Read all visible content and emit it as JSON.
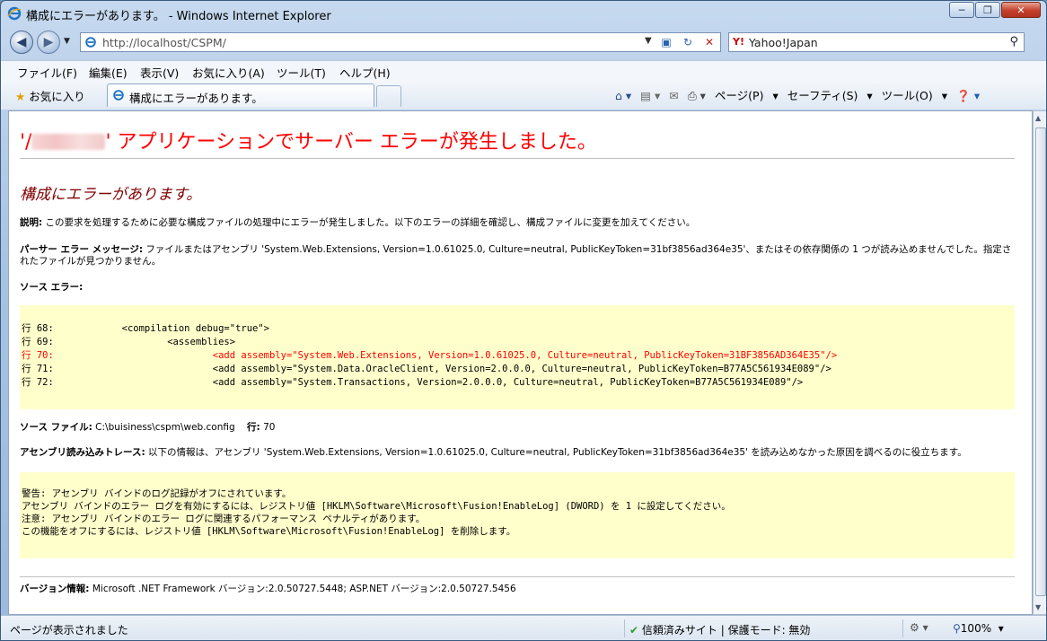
{
  "window": {
    "title": "構成にエラーがあります。 - Windows Internet Explorer"
  },
  "address_bar": {
    "url": "http://localhost/CSPM/"
  },
  "search_box": {
    "provider": "Yahoo!Japan"
  },
  "menu": {
    "items": [
      "ファイル(F)",
      "編集(E)",
      "表示(V)",
      "お気に入り(A)",
      "ツール(T)",
      "ヘルプ(H)"
    ]
  },
  "favorites_bar": {
    "favorites_label": "お気に入り",
    "tab_title": "構成にエラーがあります。",
    "page_menu": "ページ(P)",
    "safety_menu": "セーフティ(S)",
    "tools_menu": "ツール(O)"
  },
  "page": {
    "heading_prefix": "'/",
    "heading_suffix": "' アプリケーションでサーバー エラーが発生しました。",
    "subheading": "構成にエラーがあります。",
    "description_label": "説明:",
    "description_text": " この要求を処理するために必要な構成ファイルの処理中にエラーが発生しました。以下のエラーの詳細を確認し、構成ファイルに変更を加えてください。",
    "parser_label": "パーサー エラー メッセージ:",
    "parser_text": " ファイルまたはアセンブリ 'System.Web.Extensions, Version=1.0.61025.0, Culture=neutral, PublicKeyToken=31bf3856ad364e35'、またはその依存関係の 1 つが読み込めませんでした。指定されたファイルが見つかりません。",
    "source_error_label": "ソース エラー:",
    "source_lines": [
      {
        "text": "行 68:            <compilation debug=\"true\">",
        "highlight": false
      },
      {
        "text": "行 69:                    <assemblies>",
        "highlight": false
      },
      {
        "text": "行 70:                            <add assembly=\"System.Web.Extensions, Version=1.0.61025.0, Culture=neutral, PublicKeyToken=31BF3856AD364E35\"/>",
        "highlight": true
      },
      {
        "text": "行 71:                            <add assembly=\"System.Data.OracleClient, Version=2.0.0.0, Culture=neutral, PublicKeyToken=B77A5C561934E089\"/>",
        "highlight": false
      },
      {
        "text": "行 72:                            <add assembly=\"System.Transactions, Version=2.0.0.0, Culture=neutral, PublicKeyToken=B77A5C561934E089\"/>",
        "highlight": false
      }
    ],
    "source_file_label": "ソース ファイル:",
    "source_file_value": " C:\\buisiness\\cspm\\web.config",
    "line_label": "行:",
    "line_value": " 70",
    "trace_label": "アセンブリ読み込みトレース:",
    "trace_text": " 以下の情報は、アセンブリ 'System.Web.Extensions, Version=1.0.61025.0, Culture=neutral, PublicKeyToken=31bf3856ad364e35' を読み込めなかった原因を調べるのに役立ちます。",
    "trace_lines": [
      "警告: アセンブリ バインドのログ記録がオフにされています。",
      "アセンブリ バインドのエラー ログを有効にするには、レジストリ値 [HKLM\\Software\\Microsoft\\Fusion!EnableLog] (DWORD) を 1 に設定してください。",
      "注意: アセンブリ バインドのエラー ログに関連するパフォーマンス ペナルティがあります。",
      "この機能をオフにするには、レジストリ値 [HKLM\\Software\\Microsoft\\Fusion!EnableLog] を削除します。"
    ],
    "version_label": "バージョン情報:",
    "version_text": " Microsoft .NET Framework バージョン:2.0.50727.5448; ASP.NET バージョン:2.0.50727.5456"
  },
  "status_bar": {
    "message": "ページが表示されました",
    "zone": "信頼済みサイト | 保護モード: 無効",
    "zoom": "100%"
  },
  "colors": {
    "error_heading": "#ff0000",
    "subheading": "#800000",
    "code_background": "#ffffcc"
  }
}
